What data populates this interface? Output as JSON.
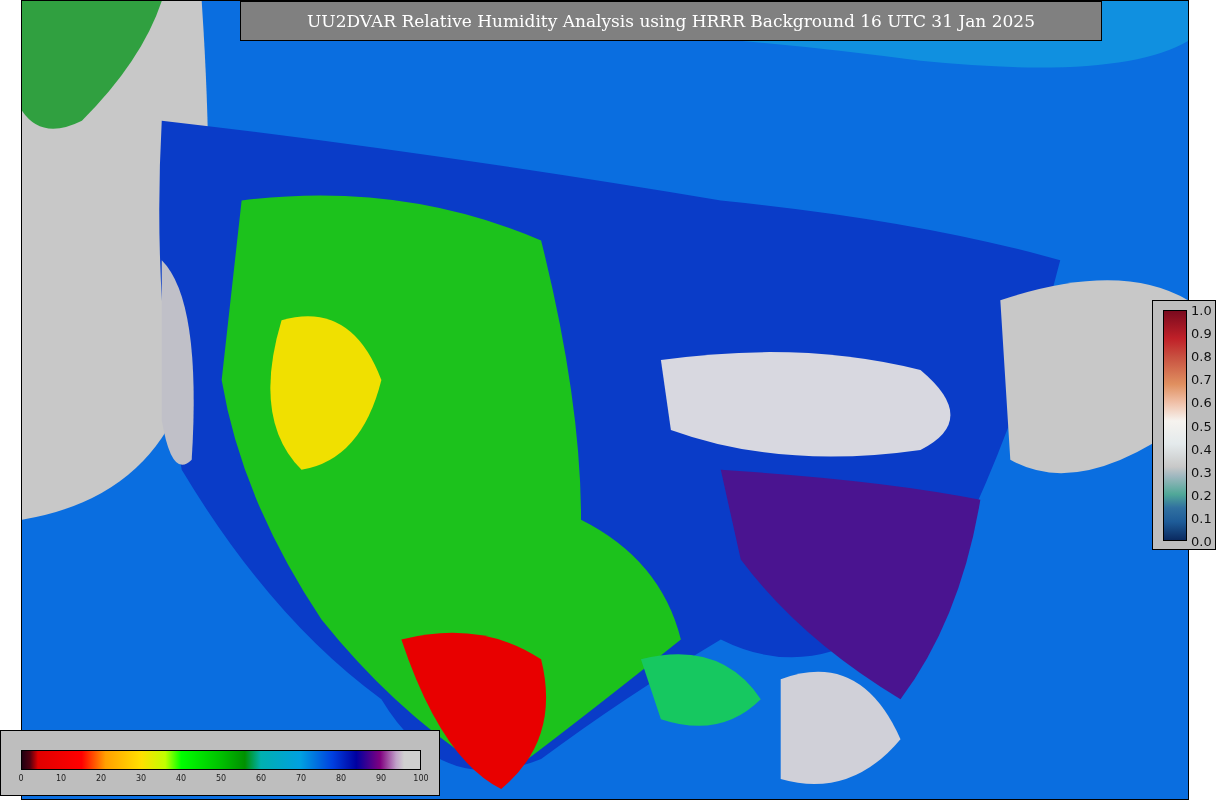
{
  "title": "UU2DVAR Relative Humidity Analysis using HRRR Background 16 UTC 31 Jan 2025",
  "humidity_colorbar": {
    "ticks": [
      "0",
      "10",
      "20",
      "30",
      "40",
      "50",
      "60",
      "70",
      "80",
      "90",
      "100"
    ]
  },
  "observation_colorbar": {
    "ticks": [
      "1.0",
      "0.9",
      "0.8",
      "0.7",
      "0.6",
      "0.5",
      "0.4",
      "0.3",
      "0.2",
      "0.1",
      "0.0"
    ]
  }
}
